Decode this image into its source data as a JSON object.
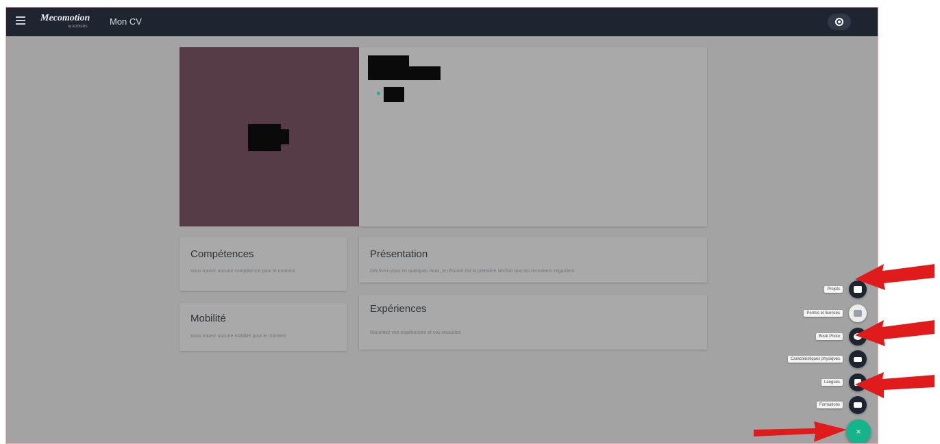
{
  "topbar": {
    "logo_text": "Mecomotion",
    "logo_sub": "by AUDIENS",
    "page_title": "Mon CV"
  },
  "sections": {
    "competences": {
      "title": "Compétences",
      "text": "Vous n'avez aucune compétence pour le moment"
    },
    "mobilite": {
      "title": "Mobilité",
      "text": "Vous n'avez aucune mobilité pour le moment"
    },
    "presentation": {
      "title": "Présentation",
      "text": "Décrivez-vous en quelques mots, le résumé est la première section que les recruteurs regardent"
    },
    "experiences": {
      "title": "Expériences",
      "text": "Racontez vos expériences et vos réussites"
    }
  },
  "fab_menu": {
    "items": [
      {
        "label": "Projets",
        "icon": "briefcase-icon"
      },
      {
        "label": "Permis et licences",
        "icon": "car-icon"
      },
      {
        "label": "Book Photo",
        "icon": "photo-book-icon"
      },
      {
        "label": "Caractéristiques physiques",
        "icon": "id-card-icon"
      },
      {
        "label": "Langues",
        "icon": "translate-icon"
      },
      {
        "label": "Formations",
        "icon": "graduation-cap-icon"
      }
    ],
    "main_button_icon": "×",
    "main_button_color": "#16b48a"
  },
  "colors": {
    "topbar": "#1f2530",
    "photo_background": "#553c47",
    "annotation_arrow": "#e01b1b"
  }
}
